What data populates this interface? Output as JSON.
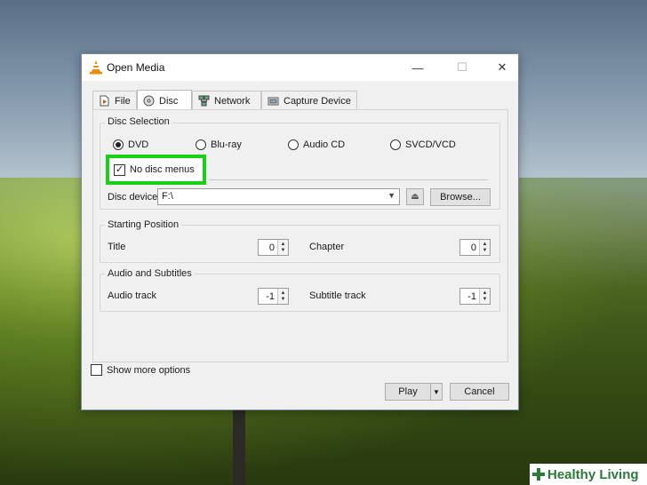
{
  "window": {
    "title": "Open Media",
    "controls": {
      "minimize": "—",
      "maximize": "☐",
      "close": "✕"
    }
  },
  "tabs": [
    {
      "label": "File",
      "icon": "file-icon",
      "active": false
    },
    {
      "label": "Disc",
      "icon": "disc-icon",
      "active": true
    },
    {
      "label": "Network",
      "icon": "network-icon",
      "active": false
    },
    {
      "label": "Capture Device",
      "icon": "capture-device-icon",
      "active": false
    }
  ],
  "disc_selection": {
    "label": "Disc Selection",
    "options": [
      {
        "label": "DVD",
        "selected": true
      },
      {
        "label": "Blu-ray",
        "selected": false
      },
      {
        "label": "Audio CD",
        "selected": false
      },
      {
        "label": "SVCD/VCD",
        "selected": false
      }
    ],
    "no_disc_menus": {
      "label": "No disc menus",
      "checked": true
    },
    "device_label": "Disc device",
    "device_value": "F:\\",
    "eject_icon": "eject-icon",
    "browse_label": "Browse..."
  },
  "starting_position": {
    "label": "Starting Position",
    "title_label": "Title",
    "title_value": "0",
    "chapter_label": "Chapter",
    "chapter_value": "0"
  },
  "audio_subtitles": {
    "label": "Audio and Subtitles",
    "audio_label": "Audio track",
    "audio_value": "-1",
    "subtitle_label": "Subtitle track",
    "subtitle_value": "-1"
  },
  "show_more_options": {
    "label": "Show more options",
    "checked": false
  },
  "buttons": {
    "play": "Play",
    "cancel": "Cancel"
  },
  "colors": {
    "highlight": "#19d019",
    "watermark": "#2c7a3a"
  },
  "watermark": "Healthy Living"
}
